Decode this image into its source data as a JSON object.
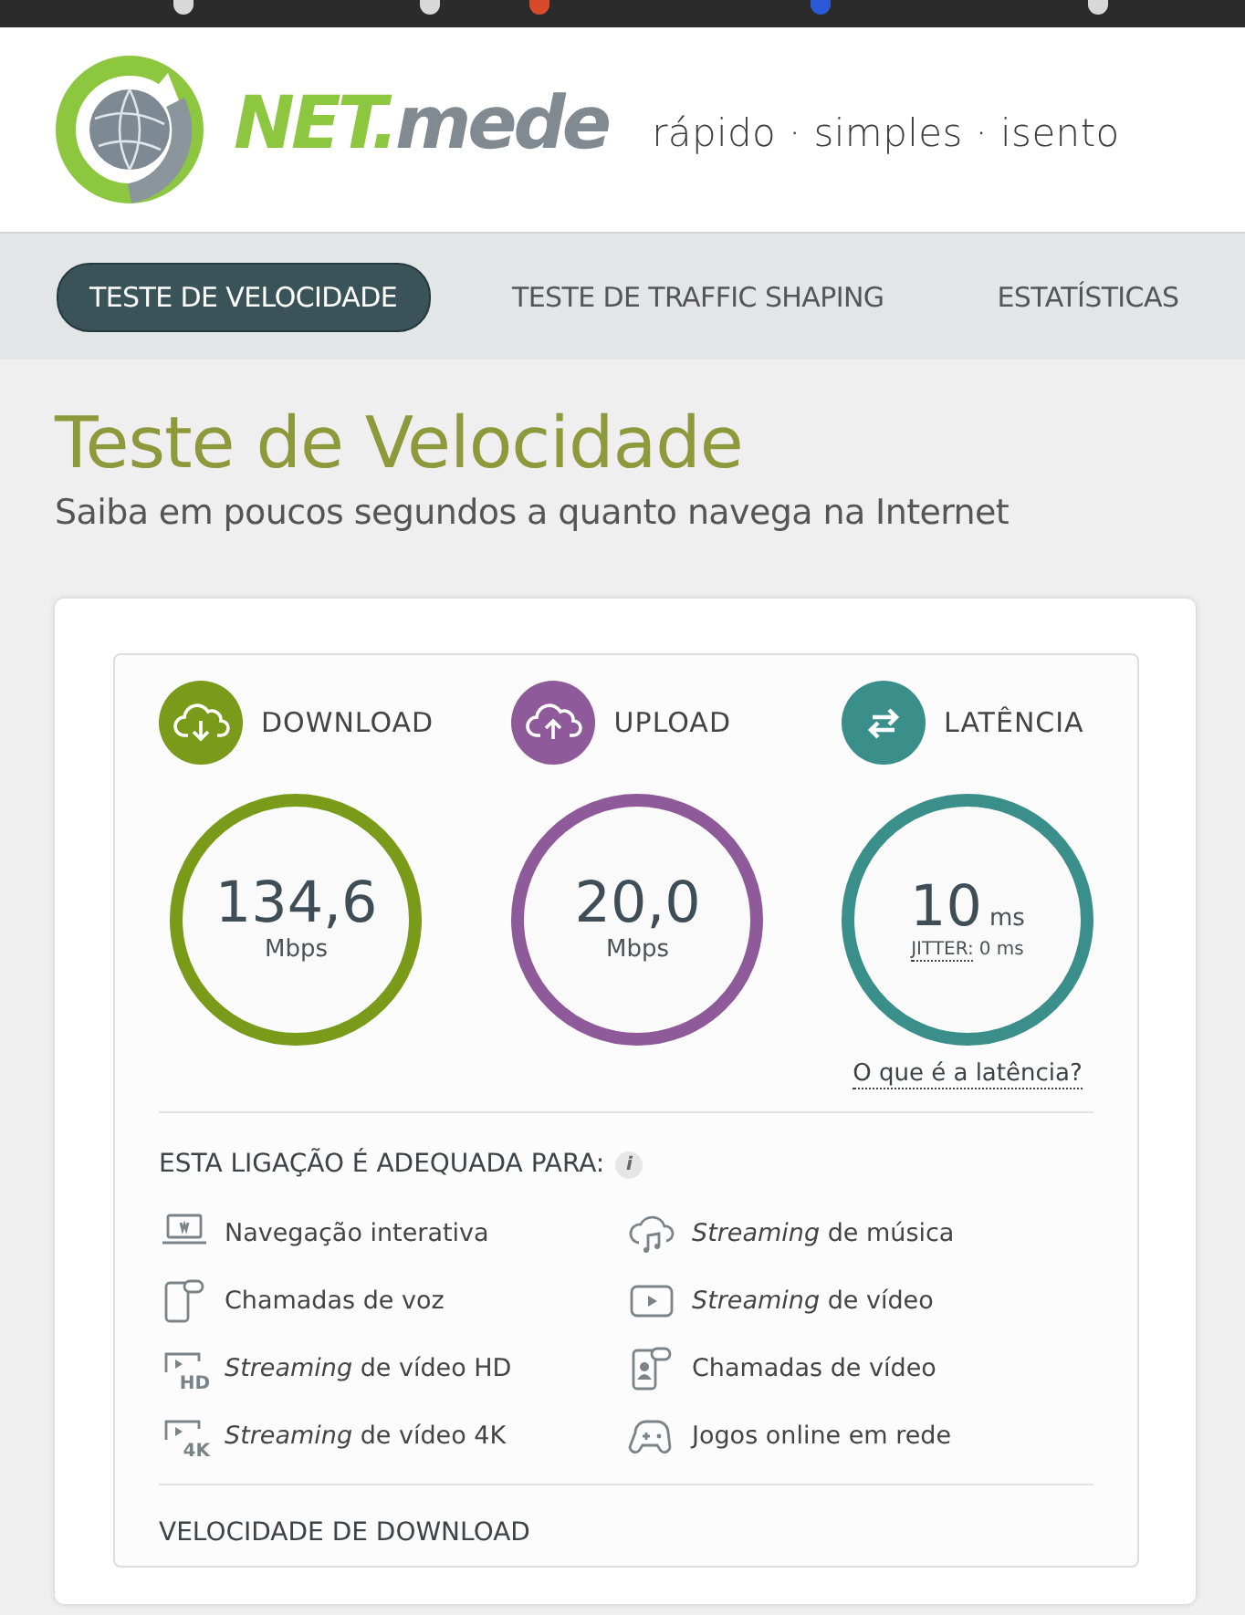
{
  "header": {
    "logo": {
      "part1": "NET.",
      "part2": "mede"
    },
    "tagline": "rápido · simples · isento"
  },
  "nav": [
    {
      "label": "TESTE DE VELOCIDADE",
      "selected": true
    },
    {
      "label": "TESTE DE TRAFFIC SHAPING",
      "selected": false
    },
    {
      "label": "ESTATÍSTICAS",
      "selected": false
    }
  ],
  "page": {
    "title": "Teste de Velocidade",
    "subtitle": "Saiba em poucos segundos a quanto navega na Internet"
  },
  "metrics": [
    {
      "kind": "download",
      "label": "DOWNLOAD",
      "color": "#7a9a1a",
      "value": "134,6",
      "unit": "Mbps"
    },
    {
      "kind": "upload",
      "label": "UPLOAD",
      "color": "#8e5a9a",
      "value": "20,0",
      "unit": "Mbps"
    },
    {
      "kind": "latency",
      "label": "LATÊNCIA",
      "color": "#3a8f8a",
      "value": "10",
      "unit": "ms",
      "jitter_label": "JITTER:",
      "jitter_value": "0 ms",
      "link": "O que é a latência?"
    }
  ],
  "suitability": {
    "heading": "ESTA LIGAÇÃO É ADEQUADA PARA:",
    "info": "i",
    "items": [
      {
        "kind": "laptop",
        "label": "Navegação interativa"
      },
      {
        "kind": "music",
        "label": "*Streaming* de música"
      },
      {
        "kind": "phone",
        "label": "Chamadas de voz"
      },
      {
        "kind": "video",
        "label": "*Streaming* de vídeo"
      },
      {
        "kind": "hd",
        "badge": "HD",
        "label": "*Streaming* de vídeo HD"
      },
      {
        "kind": "videocall",
        "label": "Chamadas de vídeo"
      },
      {
        "kind": "uhd",
        "badge": "4K",
        "label": "*Streaming* de vídeo 4K"
      },
      {
        "kind": "game",
        "label": "Jogos online em rede"
      }
    ]
  },
  "next_section": "VELOCIDADE DE DOWNLOAD"
}
